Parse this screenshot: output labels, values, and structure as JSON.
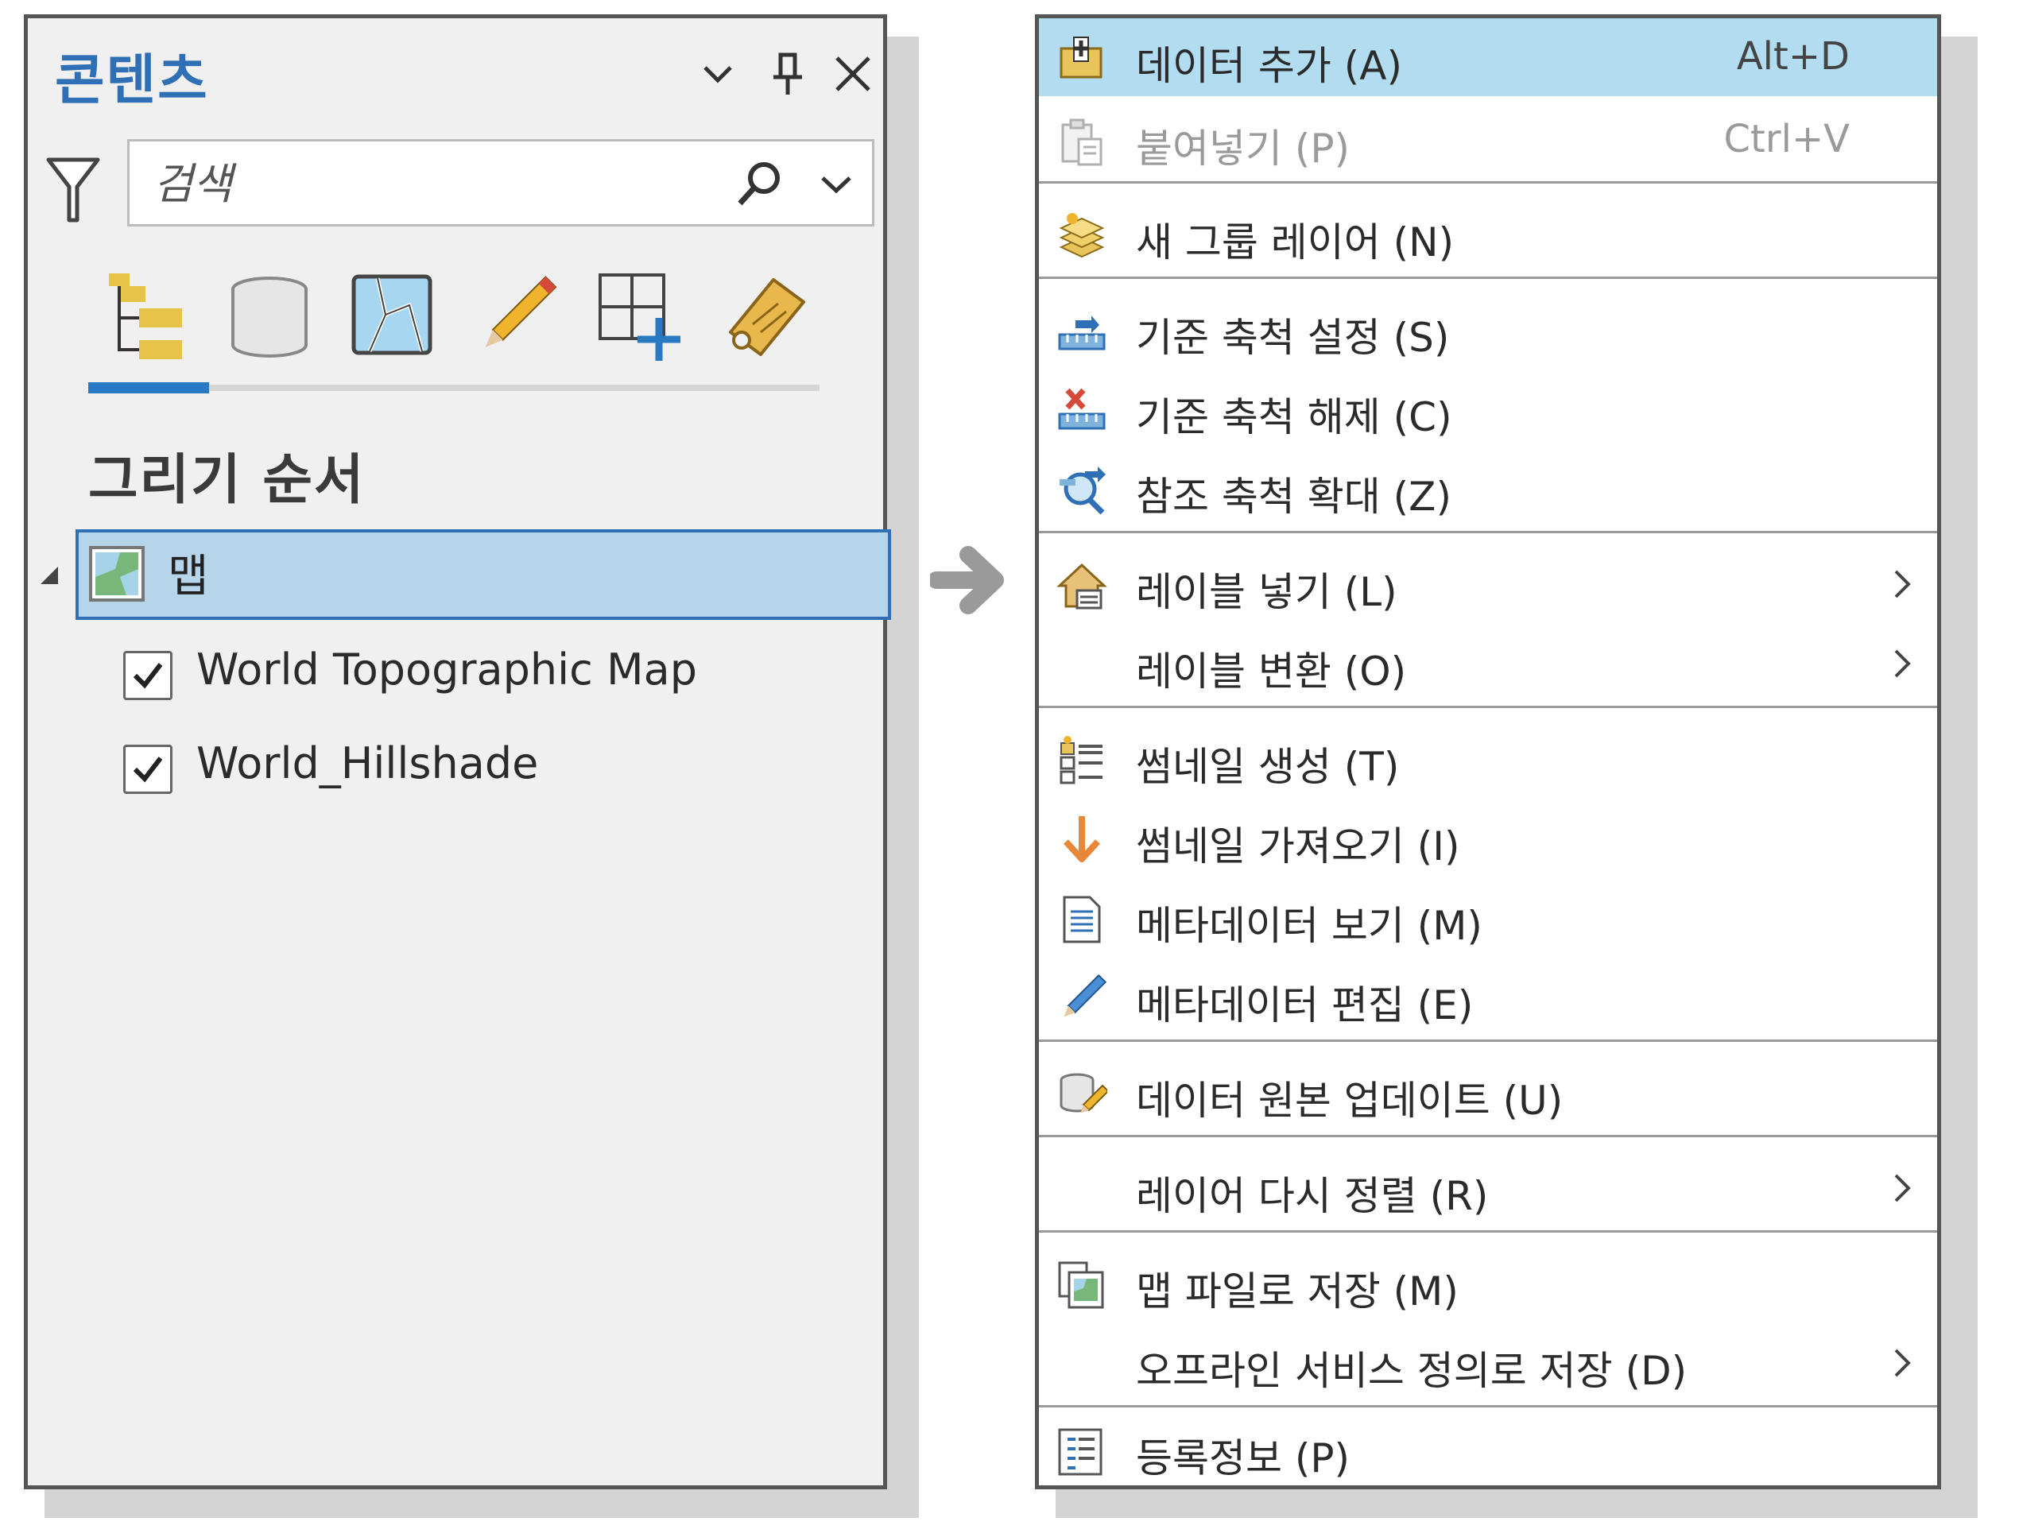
{
  "contents_pane": {
    "title": "콘텐츠",
    "search_placeholder": "검색",
    "section_heading": "그리기 순서",
    "map_label": "맵",
    "layers": [
      {
        "label": "World Topographic Map",
        "checked": true
      },
      {
        "label": "World_Hillshade",
        "checked": true
      }
    ],
    "toolbar_icons": [
      "list-by-drawing-order-icon",
      "list-by-source-icon",
      "list-by-selection-icon",
      "list-by-editing-icon",
      "list-by-snapping-icon",
      "list-by-labeling-icon"
    ]
  },
  "context_menu": {
    "items": [
      {
        "icon": "add-data-icon",
        "label": "데이터 추가 (A)",
        "shortcut": "Alt+D",
        "highlight": true
      },
      {
        "icon": "paste-icon",
        "label": "붙여넣기 (P)",
        "shortcut": "Ctrl+V",
        "disabled": true
      },
      {
        "icon": "new-group-layer-icon",
        "label": "새 그룹 레이어 (N)"
      },
      {
        "icon": "set-reference-scale-icon",
        "label": "기준 축척 설정 (S)"
      },
      {
        "icon": "clear-reference-scale-icon",
        "label": "기준 축척 해제 (C)"
      },
      {
        "icon": "zoom-to-reference-scale-icon",
        "label": "참조 축척 확대 (Z)"
      },
      {
        "icon": "label-placement-icon",
        "label": "레이블 넣기 (L)",
        "submenu": true
      },
      {
        "icon": "",
        "label": "레이블 변환 (O)",
        "submenu": true
      },
      {
        "icon": "create-thumbnail-icon",
        "label": "썸네일 생성 (T)"
      },
      {
        "icon": "import-thumbnail-icon",
        "label": "썸네일 가져오기 (I)"
      },
      {
        "icon": "view-metadata-icon",
        "label": "메타데이터 보기 (M)"
      },
      {
        "icon": "edit-metadata-icon",
        "label": "메타데이터 편집 (E)"
      },
      {
        "icon": "update-data-sources-icon",
        "label": "데이터 원본 업데이트 (U)"
      },
      {
        "icon": "",
        "label": "레이어 다시 정렬 (R)",
        "submenu": true
      },
      {
        "icon": "save-as-map-file-icon",
        "label": "맵 파일로 저장 (M)"
      },
      {
        "icon": "",
        "label": "오프라인 서비스 정의로 저장 (D)",
        "submenu": true
      },
      {
        "icon": "properties-icon",
        "label": "등록정보 (P)"
      }
    ]
  },
  "colors": {
    "accent_blue": "#2f6fb6",
    "selection_fill": "#b6d4ea",
    "menu_highlight": "#b2dcf0"
  }
}
